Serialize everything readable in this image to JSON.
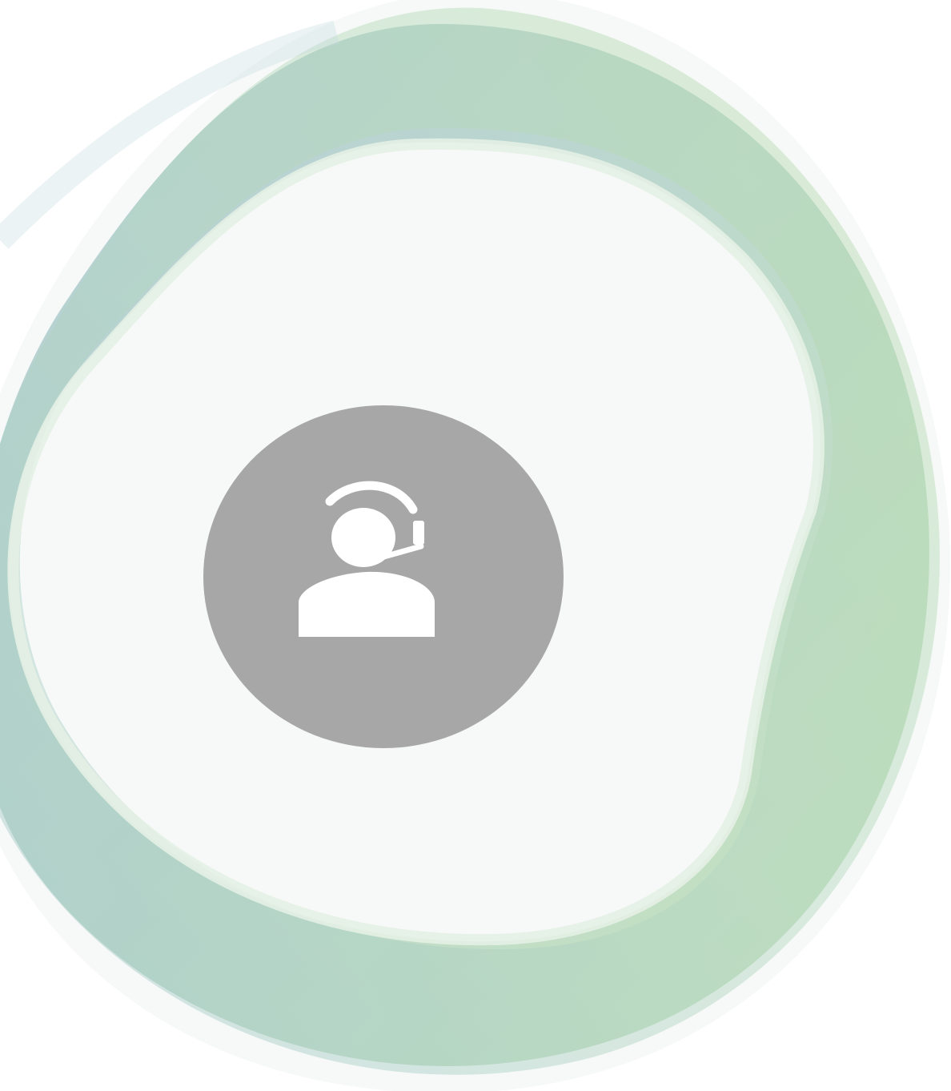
{
  "colors": {
    "background": "#ffffff",
    "badge": "#a7a7a7",
    "icon": "#ffffff",
    "swirl_blue": "#9ebfca",
    "swirl_teal": "#a9cdc0",
    "swirl_green": "#b6dcaa"
  },
  "icons": {
    "badge_icon": "customer-support-headset-icon"
  }
}
